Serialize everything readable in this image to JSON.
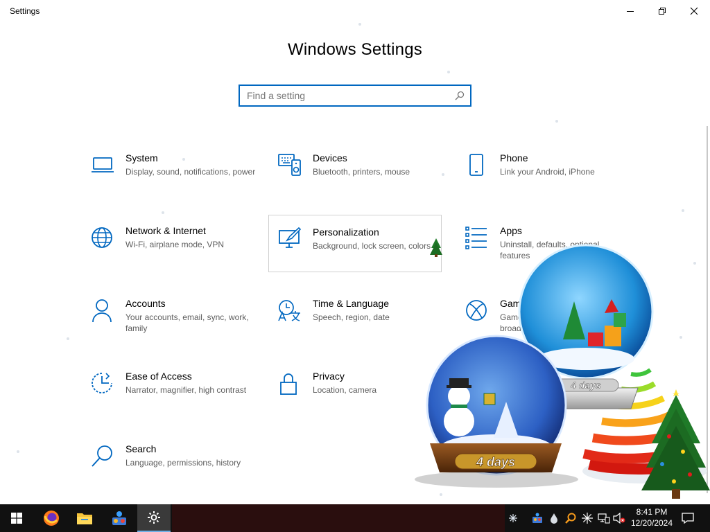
{
  "window": {
    "title": "Settings",
    "heading": "Windows Settings",
    "controls": {
      "minimize": "minimize-icon",
      "maximize": "restore-icon",
      "close": "close-icon"
    }
  },
  "search": {
    "placeholder": "Find a setting",
    "value": ""
  },
  "accent": "#0067c0",
  "tiles": [
    {
      "title": "System",
      "desc": "Display, sound, notifications, power",
      "icon": "laptop-icon"
    },
    {
      "title": "Devices",
      "desc": "Bluetooth, printers, mouse",
      "icon": "keyboard-speaker-icon"
    },
    {
      "title": "Phone",
      "desc": "Link your Android, iPhone",
      "icon": "phone-icon"
    },
    {
      "title": "Network & Internet",
      "desc": "Wi-Fi, airplane mode, VPN",
      "icon": "globe-icon"
    },
    {
      "title": "Personalization",
      "desc": "Background, lock screen, colors",
      "icon": "paint-monitor-icon"
    },
    {
      "title": "Apps",
      "desc": "Uninstall, defaults, optional features",
      "icon": "apps-list-icon"
    },
    {
      "title": "Accounts",
      "desc": "Your accounts, email, sync, work, family",
      "icon": "person-icon"
    },
    {
      "title": "Time & Language",
      "desc": "Speech, region, date",
      "icon": "time-language-icon"
    },
    {
      "title": "Gam",
      "desc": "Game broad",
      "icon": "xbox-icon"
    },
    {
      "title": "Ease of Access",
      "desc": "Narrator, magnifier, high contrast",
      "icon": "ease-of-access-icon"
    },
    {
      "title": "Privacy",
      "desc": "Location, camera",
      "icon": "lock-icon"
    },
    {
      "title": "Search",
      "desc": "Language, permissions, history",
      "icon": "magnifier-icon"
    }
  ],
  "overlay": {
    "globe_label_1": "4 days",
    "globe_label_2": "4 days"
  },
  "taskbar": {
    "apps": [
      "windows-start-icon",
      "firefox-icon",
      "file-explorer-icon",
      "app-icon",
      "settings-gear-icon"
    ],
    "tray": [
      "snowflake-icon",
      "app-tray-icon",
      "water-drop-icon",
      "search-tray-icon",
      "spark-icon",
      "network-icon",
      "volume-muted-icon"
    ],
    "time": "8:41 PM",
    "date": "12/20/2024",
    "notification": "action-center-icon"
  }
}
